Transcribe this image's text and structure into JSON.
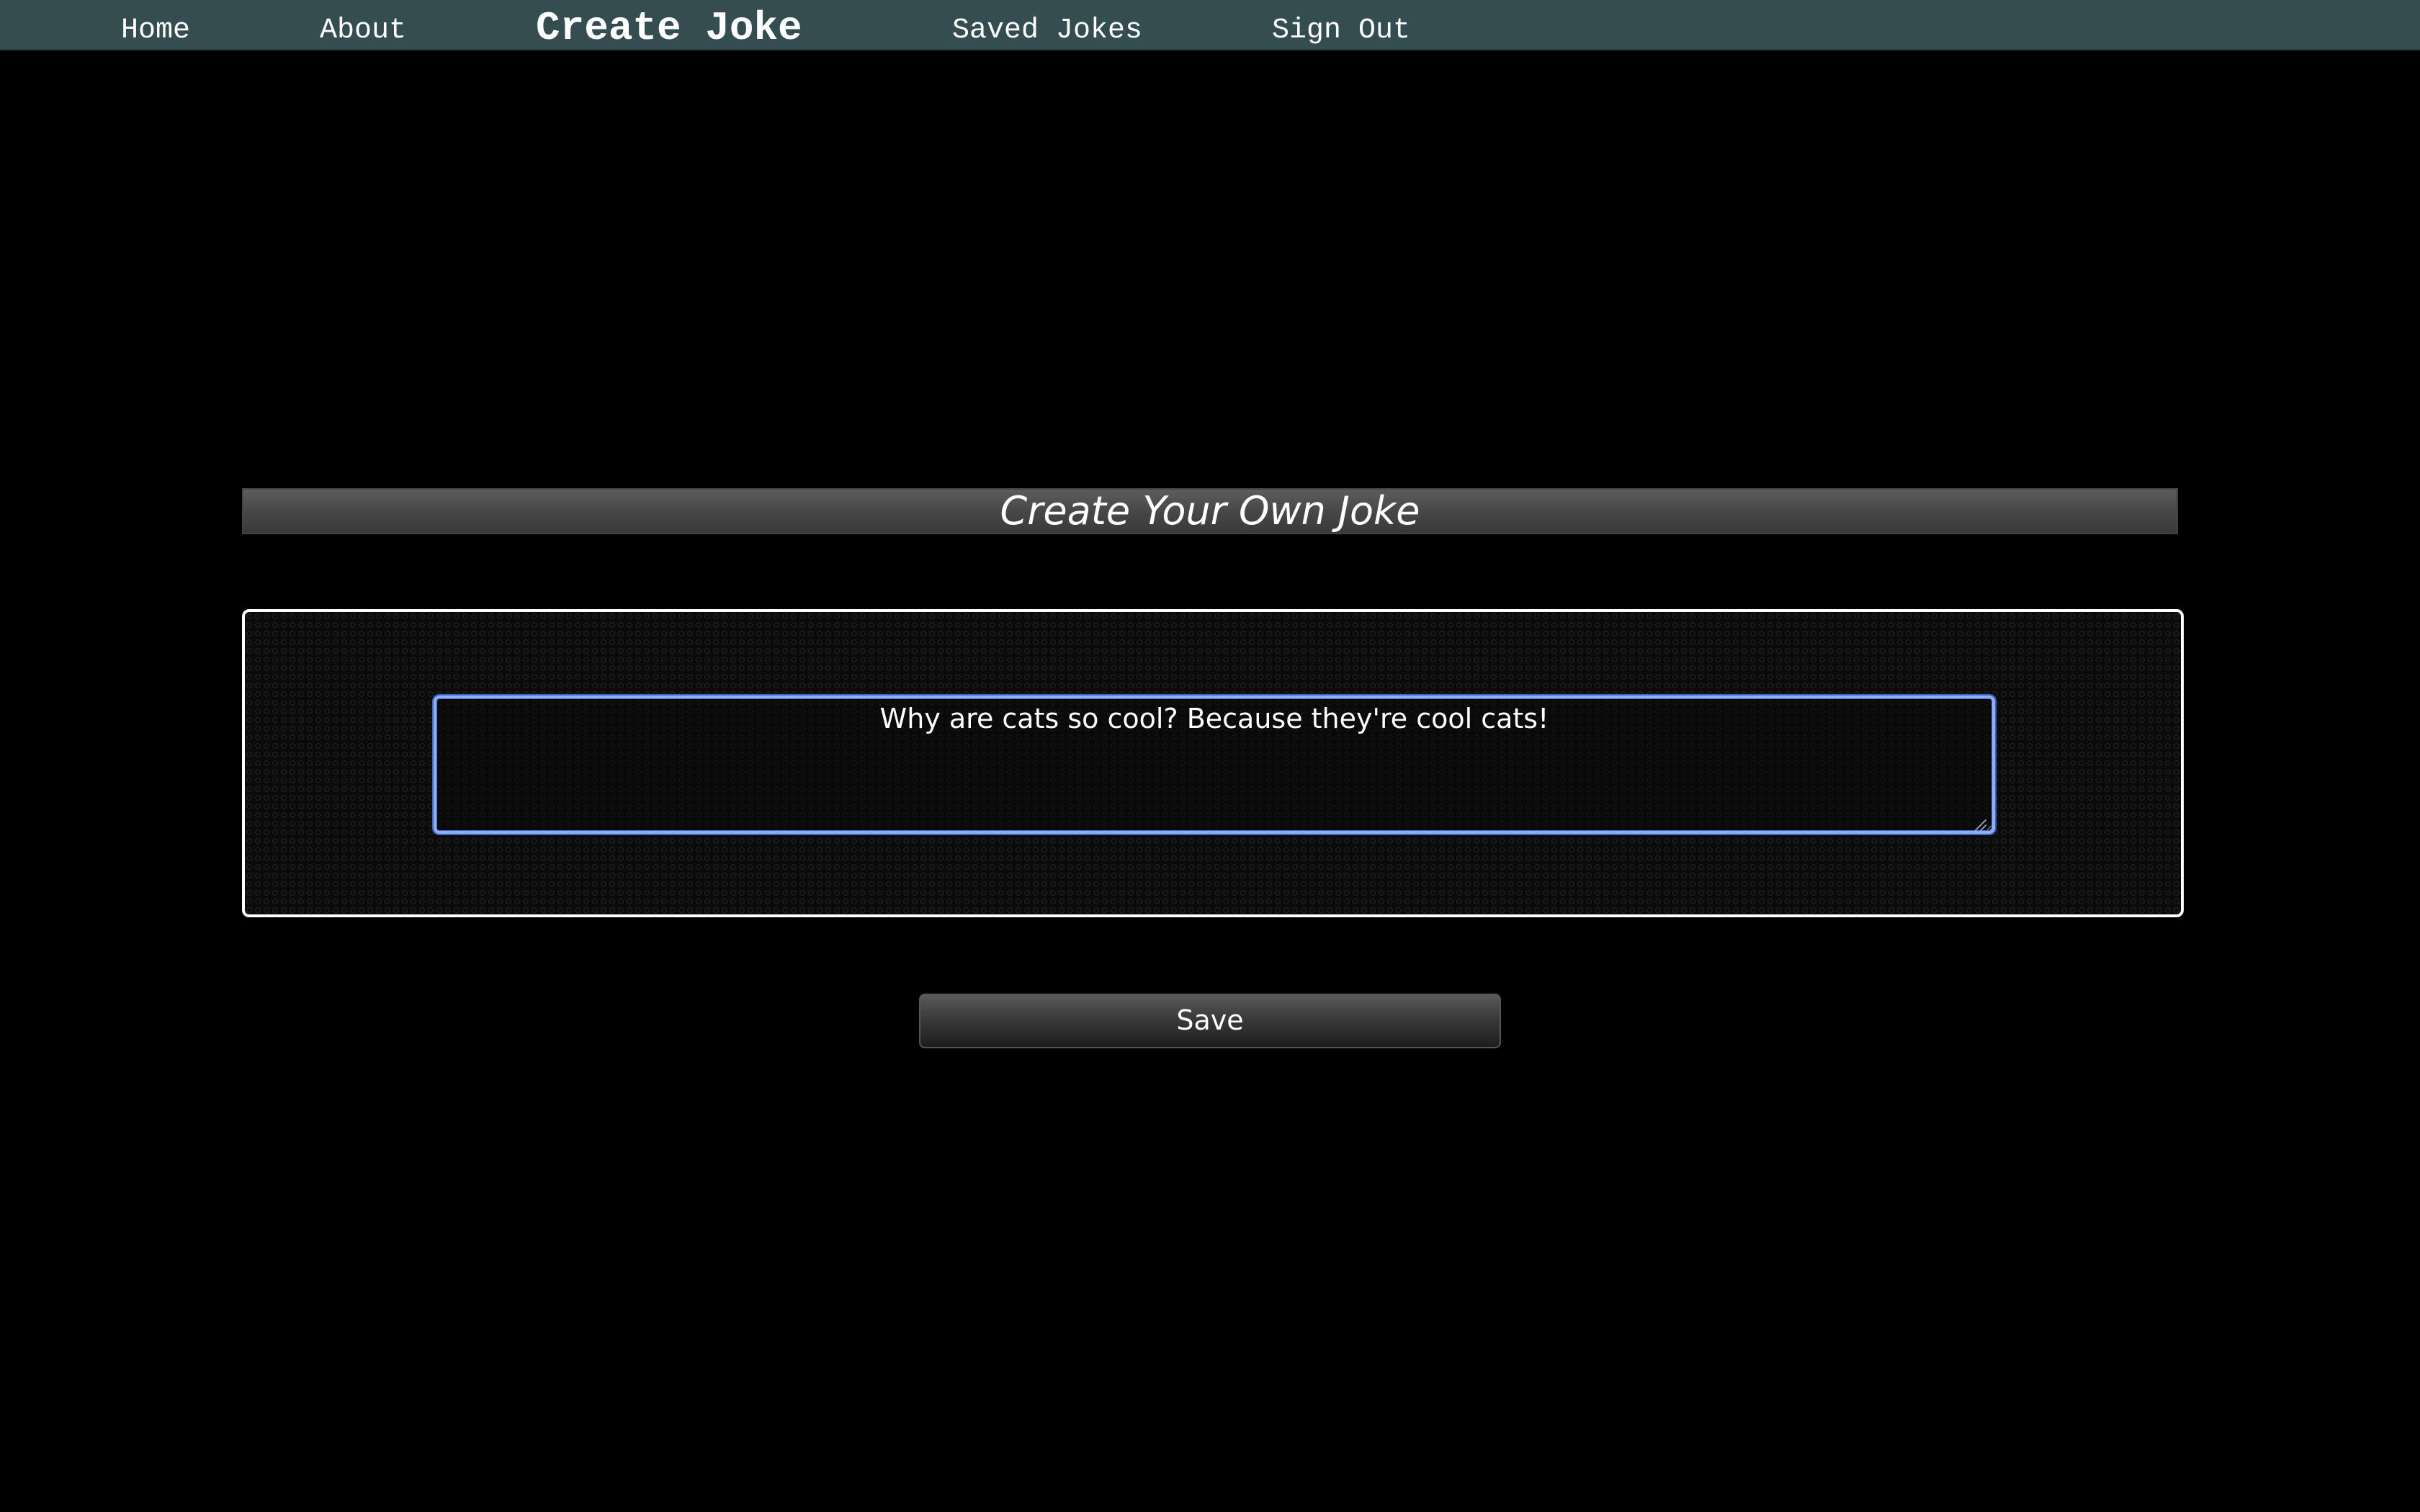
{
  "nav": {
    "items": [
      {
        "label": "Home",
        "active": false
      },
      {
        "label": "About",
        "active": false
      },
      {
        "label": "Create Joke",
        "active": true
      },
      {
        "label": "Saved Jokes",
        "active": false
      },
      {
        "label": "Sign Out",
        "active": false
      }
    ]
  },
  "main": {
    "title": "Create Your Own Joke",
    "joke_input": {
      "value": "Why are cats so cool? Because they're cool cats!"
    },
    "save_label": "Save"
  },
  "colors": {
    "navbar_background": "#344d50",
    "page_background": "#000000",
    "input_focus_border": "#8fb0f0"
  }
}
